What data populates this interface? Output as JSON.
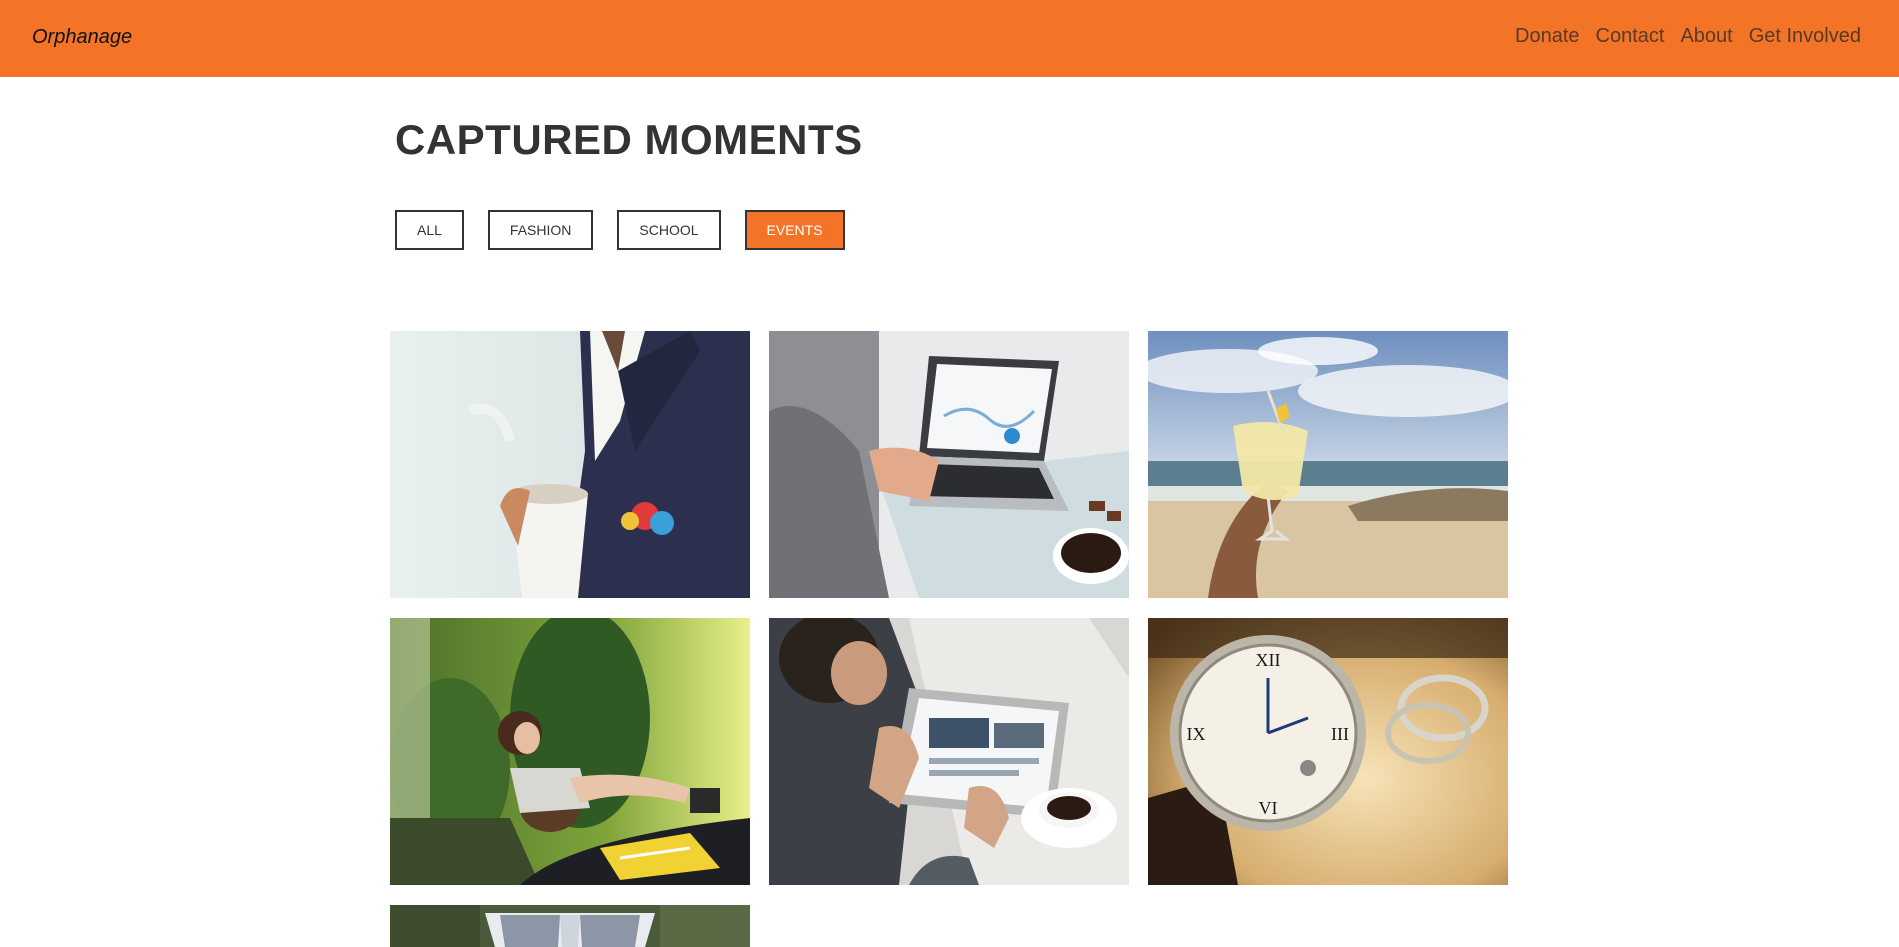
{
  "header": {
    "brand": "Orphanage",
    "nav": [
      "Donate",
      "Contact",
      "About",
      "Get Involved"
    ]
  },
  "page": {
    "title": "CAPTURED MOMENTS"
  },
  "filters": [
    {
      "label": "ALL",
      "active": false
    },
    {
      "label": "FASHION",
      "active": false
    },
    {
      "label": "SCHOOL",
      "active": false
    },
    {
      "label": "EVENTS",
      "active": true
    }
  ],
  "gallery": [
    {
      "subject": "man in suit with coffee cup and pocket square"
    },
    {
      "subject": "person typing on laptop with coffee"
    },
    {
      "subject": "hand holding cocktail on beach"
    },
    {
      "subject": "woman reclining on motorcycle"
    },
    {
      "subject": "man using tablet with coffee"
    },
    {
      "subject": "wristwatch and rings"
    },
    {
      "subject": "man in vest and tie (partially visible)"
    }
  ],
  "colors": {
    "accent": "#f37327",
    "text_dark": "#333333"
  }
}
